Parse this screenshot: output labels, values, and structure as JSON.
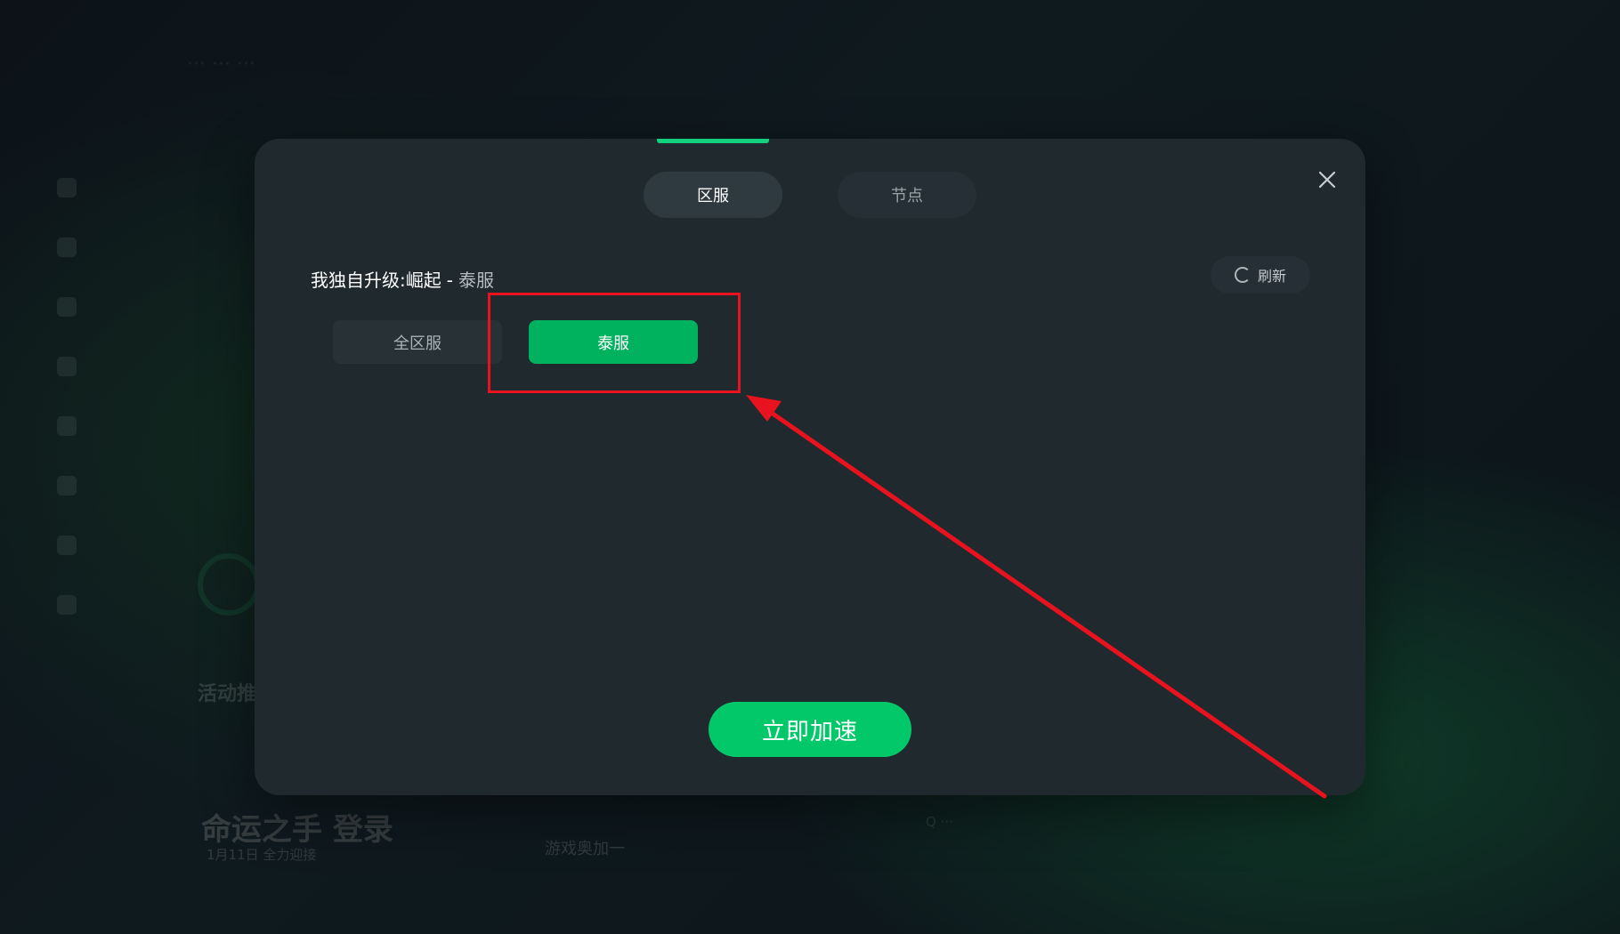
{
  "background": {
    "top_title": "··· ··· ···",
    "activity_title": "活动推",
    "banner_title": "命运之手 登录",
    "banner_date": "1月11日  全力迎接",
    "banner_mid": "游戏奥加一",
    "banner_right": "Q ···"
  },
  "dialog": {
    "tabs": [
      {
        "label": "区服",
        "active": true
      },
      {
        "label": "节点",
        "active": false
      }
    ],
    "close_icon": "close-icon",
    "heading": {
      "game_name": "我独自升级:崛起",
      "separator": "-",
      "region": "泰服"
    },
    "refresh_label": "刷新",
    "servers": [
      {
        "label": "全区服",
        "selected": false
      },
      {
        "label": "泰服",
        "selected": true
      }
    ],
    "accelerate_label": "立即加速"
  },
  "colors": {
    "accent": "#12d07c",
    "selected": "#00b15e",
    "primary_button": "#03c86a",
    "annotation": "#e8131e",
    "modal_bg": "#20292e"
  }
}
